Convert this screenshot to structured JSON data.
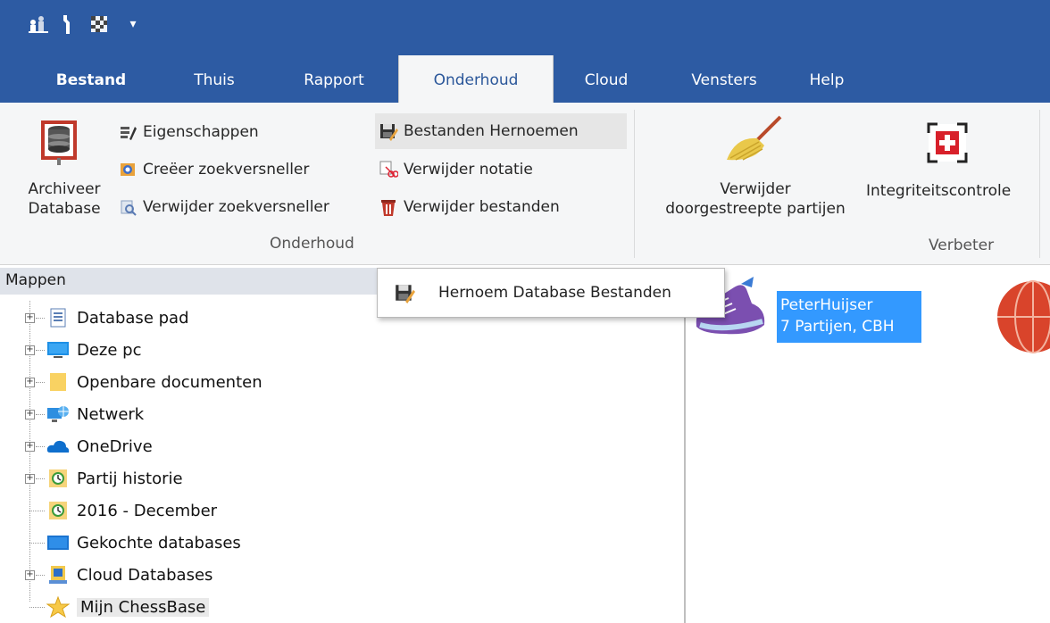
{
  "quick_access": {
    "icons": [
      "chess-pieces-icon",
      "wrench-icon",
      "board-icon",
      "dropdown-arrow-icon"
    ],
    "dropdown_glyph": "▾"
  },
  "tabs": [
    {
      "label": "Bestand"
    },
    {
      "label": "Thuis"
    },
    {
      "label": "Rapport"
    },
    {
      "label": "Onderhoud"
    },
    {
      "label": "Cloud"
    },
    {
      "label": "Vensters"
    },
    {
      "label": "Help"
    }
  ],
  "ribbon": {
    "archive": {
      "line1": "Archiveer",
      "line2": "Database"
    },
    "eigenschappen": "Eigenschappen",
    "creeer_zoekversneller": "Creëer zoekversneller",
    "verwijder_zoekversneller": "Verwijder zoekversneller",
    "bestanden_hernoemen": "Bestanden Hernoemen",
    "verwijder_notatie": "Verwijder notatie",
    "verwijder_bestanden": "Verwijder bestanden",
    "group_onderhoud": "Onderhoud",
    "verwijder_doorgestreept": {
      "line1": "Verwijder",
      "line2": "doorgestreepte partijen"
    },
    "integriteit": "Integriteitscontrole",
    "group_verbeter": "Verbeter"
  },
  "popup": {
    "label": "Hernoem Database Bestanden"
  },
  "mappen": {
    "header": "Mappen",
    "items": [
      {
        "label": "Database pad"
      },
      {
        "label": "Deze pc"
      },
      {
        "label": "Openbare documenten"
      },
      {
        "label": "Netwerk"
      },
      {
        "label": "OneDrive"
      },
      {
        "label": "Partij historie"
      },
      {
        "label": "2016 - December"
      },
      {
        "label": "Gekochte databases"
      },
      {
        "label": "Cloud Databases"
      },
      {
        "label": "Mijn ChessBase"
      }
    ]
  },
  "databases": {
    "selected": {
      "name": "PeterHuijser",
      "info": "7 Partijen, CBH"
    }
  },
  "colors": {
    "titlebar": "#2d5ba3",
    "selection": "#3399ff",
    "ribbon_bg": "#f5f6f7"
  }
}
